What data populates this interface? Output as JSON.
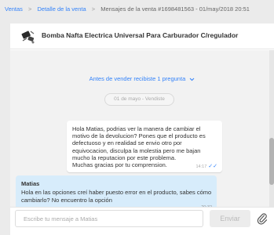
{
  "breadcrumb": {
    "ventas": "Ventas",
    "separator": ">",
    "detalle": "Detalle de la venta",
    "current": "Mensajes de la venta #1698481563 - 01/may/2018 20:51"
  },
  "product": {
    "title": "Bomba Nafta Electrica Universal Para Carburador C/regulador"
  },
  "chat": {
    "before_link": "Antes de vender recibiste 1 pregunta",
    "before_link_icon": "chevron-down-icon",
    "date_pill": "01 de mayo - Vendiste",
    "outgoing": {
      "text": "Hola Matias, podrias ver la manera de cambiar el motivo de la devolucion? Pones que el producto es defectuoso y en realidad se envio otro por equivocacion, disculpa la molestia pero me bajan mucho la reputacion por este problema.\nMuchas gracias por tu comprension.",
      "time": "14:17",
      "status_icon": "double-check-icon",
      "status_color": "#3483fa"
    },
    "incoming": {
      "sender": "Matias",
      "text": "Hola en las opciones creí haber puesto error en el producto, sabes cómo cambiarlo? No encuentro la opción",
      "time": "20:32"
    }
  },
  "composer": {
    "placeholder": "Escribe tu mensaje a Matias",
    "value": "",
    "send_label": "Enviar",
    "attach_icon": "paperclip-icon"
  },
  "colors": {
    "accent": "#3483fa",
    "incoming_bubble": "#d7ecfb",
    "chat_background": "#f2f2f2"
  }
}
